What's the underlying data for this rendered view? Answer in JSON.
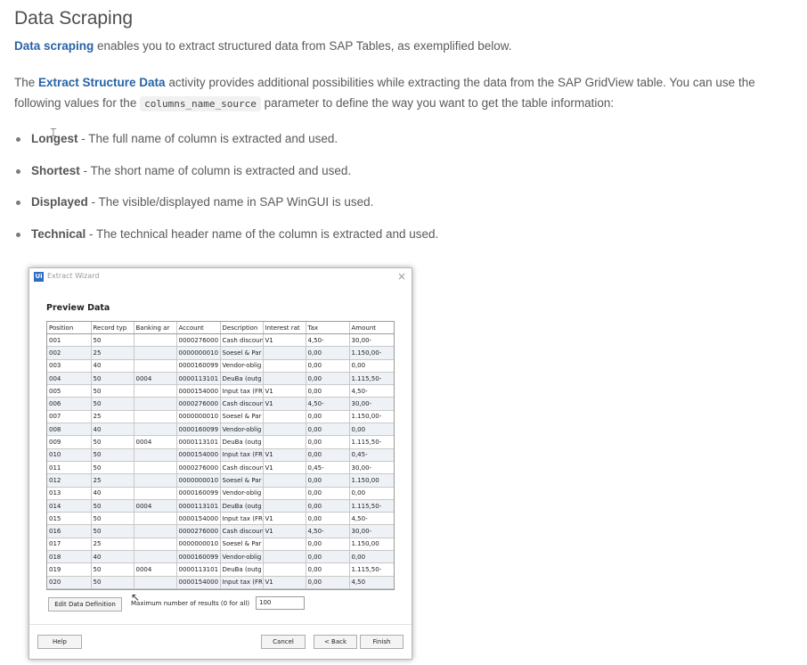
{
  "doc": {
    "title": "Data Scraping",
    "intro_link": "Data scraping",
    "intro_rest": " enables you to extract structured data from SAP Tables, as exemplified below.",
    "p2_pre": "The ",
    "p2_bold": "Extract Structure Data",
    "p2_mid": " activity provides additional possibilities while extracting the data from the SAP GridView table. You can use the following values for the ",
    "p2_code": "columns_name_source",
    "p2_post": " parameter to define the way you want to get the table information:",
    "bullets": [
      {
        "term": "Longest",
        "desc": " - The full name of column is extracted and used."
      },
      {
        "term": "Shortest",
        "desc": " - The short name of column is extracted and used."
      },
      {
        "term": "Displayed",
        "desc": " - The visible/displayed name in SAP WinGUI is used."
      },
      {
        "term": "Technical",
        "desc": " - The technical header name of the column is extracted and used."
      }
    ]
  },
  "dialog": {
    "app_icon": "Ui",
    "title": "Extract Wizard",
    "close_icon": "×",
    "preview_title": "Preview Data",
    "columns": [
      "Position",
      "Record typ",
      "Banking ar",
      "Account",
      "Description",
      "Interest rat",
      "Tax",
      "Amount"
    ],
    "rows": [
      [
        "001",
        "50",
        "",
        "0000276000",
        "Cash discount",
        "V1",
        "4,50-",
        "30,00-"
      ],
      [
        "002",
        "25",
        "",
        "0000000010",
        "Soesel & Par",
        "",
        "0,00",
        "1.150,00-"
      ],
      [
        "003",
        "40",
        "",
        "0000160099",
        "Vendor-oblig",
        "",
        "0,00",
        "0,00"
      ],
      [
        "004",
        "50",
        "0004",
        "0000113101",
        "DeuBa (outg",
        "",
        "0,00",
        "1.115,50-"
      ],
      [
        "005",
        "50",
        "",
        "0000154000",
        "Input tax (FR",
        "V1",
        "0,00",
        "4,50-"
      ],
      [
        "006",
        "50",
        "",
        "0000276000",
        "Cash discount",
        "V1",
        "4,50-",
        "30,00-"
      ],
      [
        "007",
        "25",
        "",
        "0000000010",
        "Soesel & Par",
        "",
        "0,00",
        "1.150,00-"
      ],
      [
        "008",
        "40",
        "",
        "0000160099",
        "Vendor-oblig",
        "",
        "0,00",
        "0,00"
      ],
      [
        "009",
        "50",
        "0004",
        "0000113101",
        "DeuBa (outg",
        "",
        "0,00",
        "1.115,50-"
      ],
      [
        "010",
        "50",
        "",
        "0000154000",
        "Input tax (FR",
        "V1",
        "0,00",
        "0,45-"
      ],
      [
        "011",
        "50",
        "",
        "0000276000",
        "Cash discount",
        "V1",
        "0,45-",
        "30,00-"
      ],
      [
        "012",
        "25",
        "",
        "0000000010",
        "Soesel & Par",
        "",
        "0,00",
        "1.150,00"
      ],
      [
        "013",
        "40",
        "",
        "0000160099",
        "Vendor-oblig",
        "",
        "0,00",
        "0,00"
      ],
      [
        "014",
        "50",
        "0004",
        "0000113101",
        "DeuBa (outg",
        "",
        "0,00",
        "1.115,50-"
      ],
      [
        "015",
        "50",
        "",
        "0000154000",
        "Input tax (FR",
        "V1",
        "0,00",
        "4,50-"
      ],
      [
        "016",
        "50",
        "",
        "0000276000",
        "Cash discount",
        "V1",
        "4,50-",
        "30,00-"
      ],
      [
        "017",
        "25",
        "",
        "0000000010",
        "Soesel & Par",
        "",
        "0,00",
        "1.150,00"
      ],
      [
        "018",
        "40",
        "",
        "0000160099",
        "Vendor-oblig",
        "",
        "0,00",
        "0,00"
      ],
      [
        "019",
        "50",
        "0004",
        "0000113101",
        "DeuBa (outg",
        "",
        "0,00",
        "1.115,50-"
      ],
      [
        "020",
        "50",
        "",
        "0000154000",
        "Input tax (FR",
        "V1",
        "0,00",
        "4,50"
      ]
    ],
    "edit_button": "Edit Data Definition",
    "max_label": "Maximum number of results (0 for all)",
    "max_value": "100",
    "help_button": "Help",
    "cancel_button": "Cancel",
    "back_button": "< Back",
    "finish_button": "Finish"
  },
  "colors": {
    "link": "#2762a6",
    "text": "#5a5a5a",
    "row_alt": "#eef2f7"
  }
}
